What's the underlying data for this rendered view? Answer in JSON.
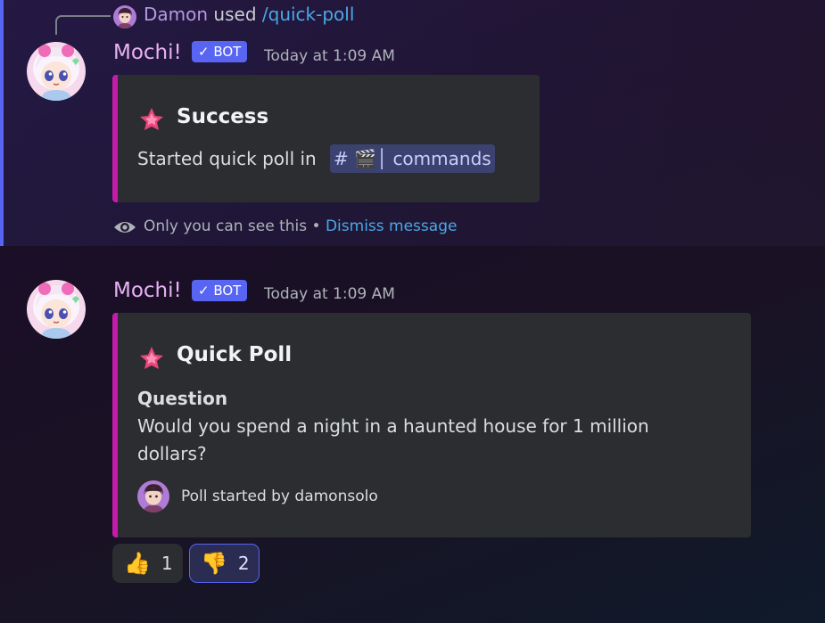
{
  "reply": {
    "username": "Damon",
    "used_text": "used",
    "command": "/quick-poll"
  },
  "messages": [
    {
      "author": "Mochi!",
      "badge": "BOT",
      "timestamp": "Today at 1:09 AM",
      "embed": {
        "title": "Success",
        "description_prefix": "Started quick poll in",
        "channel_mention": "commands",
        "accent_color": "#c41ca8"
      },
      "ephemeral": {
        "text": "Only you can see this",
        "separator": "•",
        "dismiss_label": "Dismiss message"
      }
    },
    {
      "author": "Mochi!",
      "badge": "BOT",
      "timestamp": "Today at 1:09 AM",
      "embed": {
        "title": "Quick Poll",
        "field_name": "Question",
        "field_value": "Would you spend a night in a haunted house for 1 million dollars?",
        "footer": "Poll started by damonsolo",
        "accent_color": "#c41ca8"
      },
      "reactions": [
        {
          "emoji": "👍",
          "count": "1",
          "active": false
        },
        {
          "emoji": "👎",
          "count": "2",
          "active": true
        }
      ]
    }
  ],
  "colors": {
    "brand": "#5865f2",
    "username": "#e8b2f3",
    "link": "#4aa8e8",
    "embed_bg": "#2b2d31"
  }
}
